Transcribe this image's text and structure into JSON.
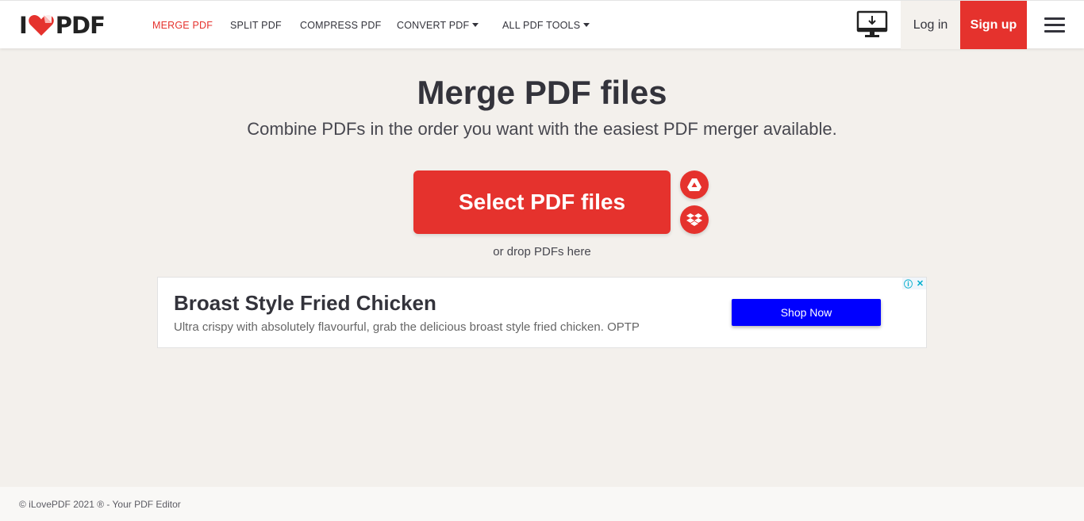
{
  "header": {
    "logo": {
      "left": "I",
      "right": "PDF"
    },
    "nav": [
      {
        "label": "MERGE PDF",
        "active": true
      },
      {
        "label": "SPLIT PDF"
      },
      {
        "label": "COMPRESS PDF"
      },
      {
        "label": "CONVERT PDF",
        "dropdown": true
      },
      {
        "label": "ALL PDF TOOLS",
        "dropdown": true
      }
    ],
    "desktop_icon": "desktop-download-icon",
    "login_label": "Log in",
    "signup_label": "Sign up",
    "menu_icon": "hamburger-icon"
  },
  "main": {
    "title": "Merge PDF files",
    "subtitle": "Combine PDFs in the order you want with the easiest PDF merger available.",
    "select_label": "Select PDF files",
    "cloud_icons": [
      "google-drive-icon",
      "dropbox-icon"
    ],
    "drop_text": "or drop PDFs here"
  },
  "ad": {
    "title": "Broast Style Fried Chicken",
    "description": "Ultra crispy with absolutely flavourful, grab the delicious broast style fried chicken. OPTP",
    "cta": "Shop Now",
    "info_icon": "ⓘ",
    "close_icon": "✕"
  },
  "footer": {
    "text": "© iLovePDF 2021 ® - Your PDF Editor"
  },
  "colors": {
    "brand_red": "#e5322d",
    "background": "#f3f0ec",
    "ad_blue": "#0000ff"
  }
}
